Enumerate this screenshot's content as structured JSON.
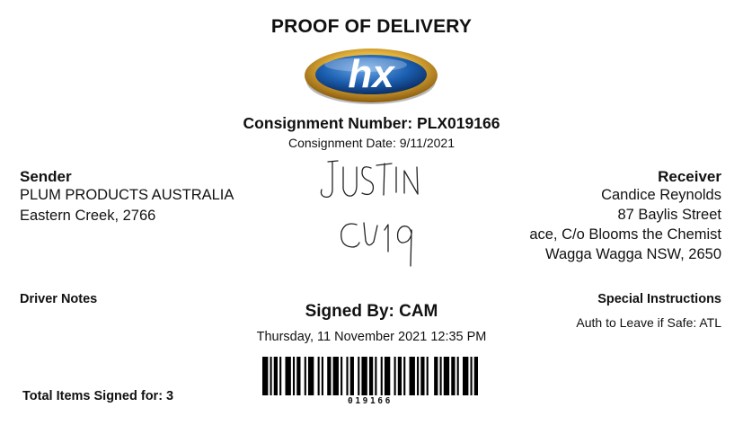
{
  "document": {
    "title": "PROOF OF DELIVERY",
    "logo_text": "hx",
    "consignment_number": "Consignment Number: PLX019166",
    "consignment_date": "Consignment Date: 9/11/2021"
  },
  "sender": {
    "heading": "Sender",
    "name": "PLUM PRODUCTS AUSTRALIA",
    "suburb": "Eastern Creek, 2766"
  },
  "receiver": {
    "heading": "Receiver",
    "name": "Candice Reynolds",
    "street": "87 Baylis Street",
    "address_line": "ace, C/o Blooms the Chemist",
    "city": "Wagga Wagga NSW, 2650"
  },
  "signature": {
    "handwritten_line1": "JUSTIN",
    "handwritten_line2": "CV19"
  },
  "notes": {
    "driver_notes_heading": "Driver Notes",
    "special_instructions_heading": "Special Instructions",
    "special_instructions_value": "Auth to Leave if Safe: ATL"
  },
  "signed": {
    "signed_by": "Signed By: CAM",
    "signed_datetime": "Thursday, 11 November 2021 12:35 PM"
  },
  "barcode": {
    "value": "019166"
  },
  "totals": {
    "total_items": "Total Items Signed for: 3"
  },
  "colors": {
    "logo_outer_gold": "#d9a52a",
    "logo_blue": "#1b5fb0",
    "text": "#111111"
  }
}
